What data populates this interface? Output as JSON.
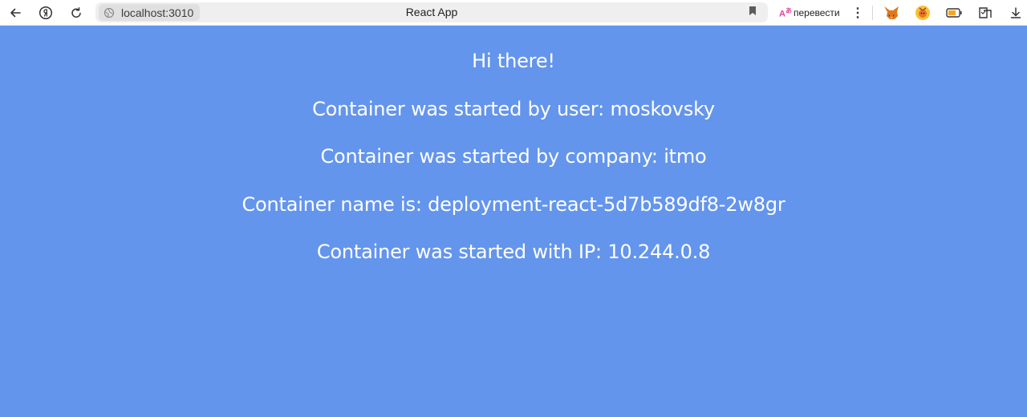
{
  "browser": {
    "url": "localhost:3010",
    "tab_title": "React App",
    "translate_label": "перевести",
    "translate_icon": "translate-icon",
    "toolbar_icons": [
      "back-arrow-icon",
      "yandex-logo-icon",
      "reload-icon",
      "site-info-icon",
      "bookmark-icon",
      "more-menu-icon",
      "metamask-fox-icon",
      "extension-badge-icon",
      "battery-icon",
      "downloads-panel-icon",
      "download-icon"
    ]
  },
  "page": {
    "background_color": "#6495ED",
    "greeting": "Hi there!",
    "user_line": "Container was started by user: moskovsky",
    "company_line": "Container was started by company: itmo",
    "name_line": "Container name is: deployment-react-5d7b589df8-2w8gr",
    "ip_line": "Container was started with IP: 10.244.0.8"
  }
}
